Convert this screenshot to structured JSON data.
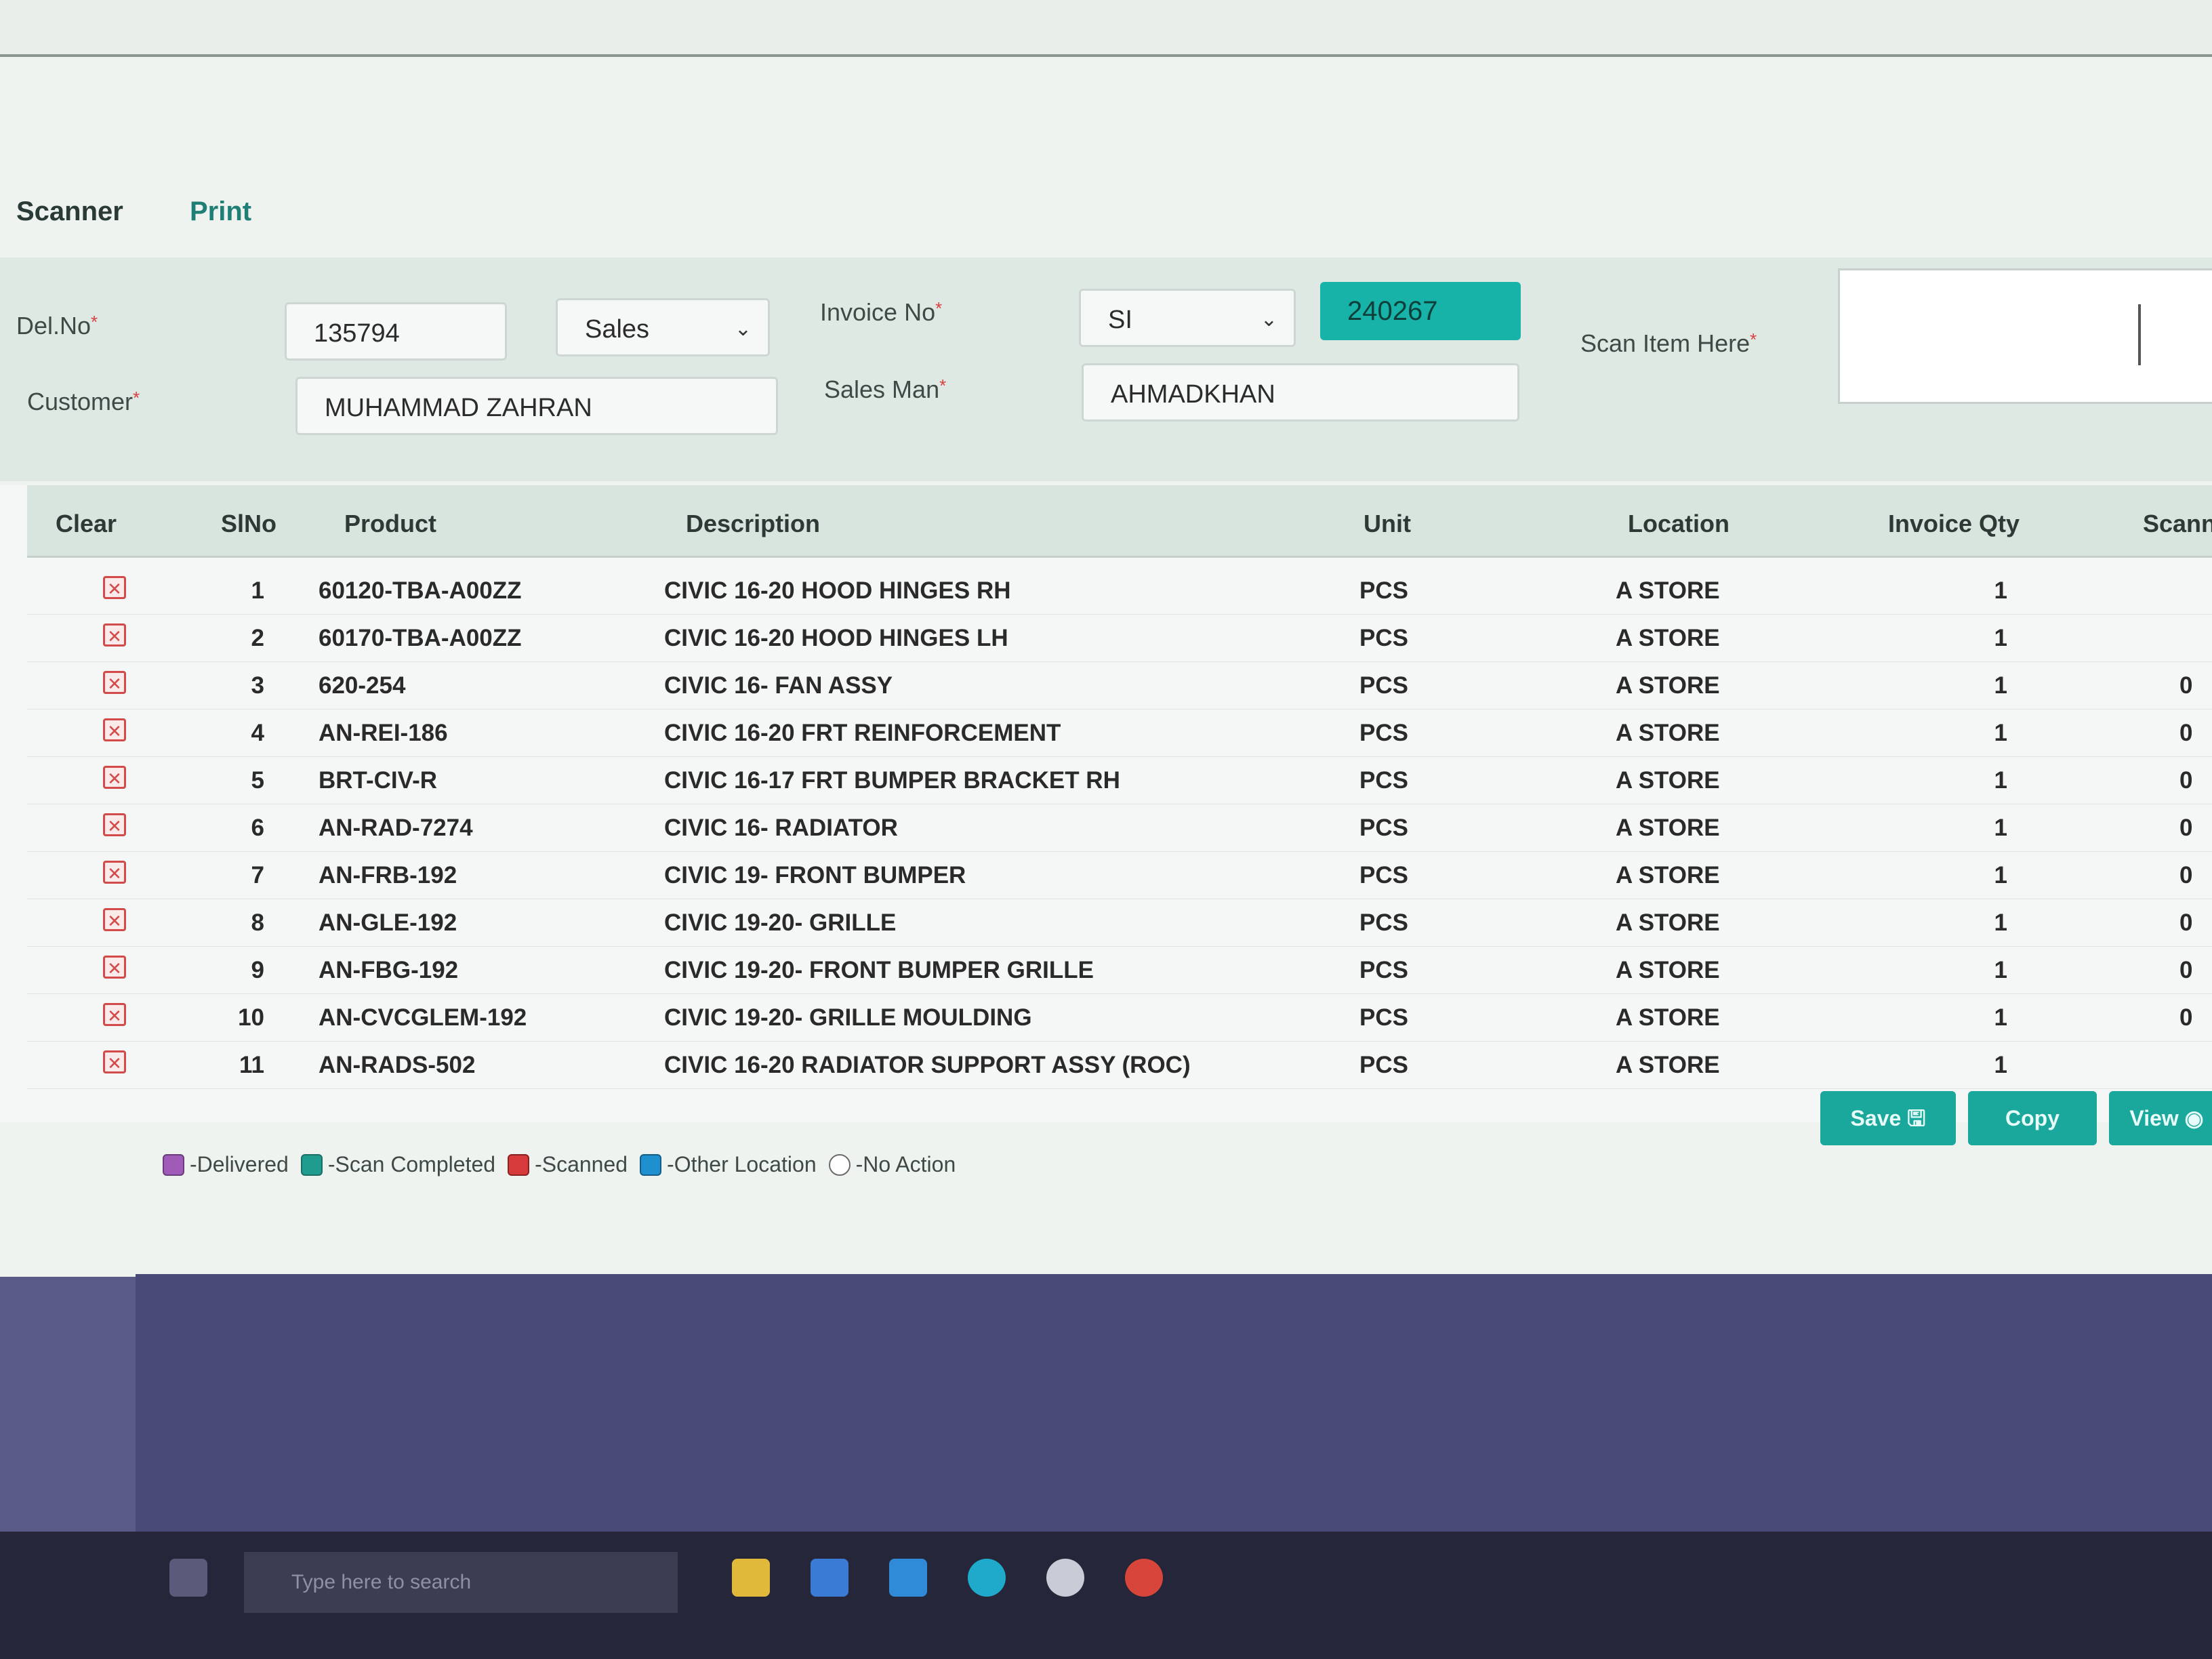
{
  "tabs": [
    {
      "label": "Scanner"
    },
    {
      "label": "Print"
    }
  ],
  "form": {
    "del_no_label": "Del.No",
    "del_no_value": "135794",
    "del_type_value": "Sales",
    "invoice_no_label": "Invoice No",
    "invoice_type_value": "SI",
    "invoice_number_value": "240267",
    "customer_label": "Customer",
    "customer_value": "MUHAMMAD ZAHRAN",
    "sales_man_label": "Sales Man",
    "sales_man_value": "AHMADKHAN",
    "scan_label": "Scan Item Here"
  },
  "table": {
    "headers": {
      "clear": "Clear",
      "slno": "SlNo",
      "product": "Product",
      "description": "Description",
      "unit": "Unit",
      "location": "Location",
      "invoice_qty": "Invoice Qty",
      "scanned": "Scann"
    },
    "rows": [
      {
        "slno": "1",
        "product": "60120-TBA-A00ZZ",
        "description": "CIVIC 16-20 HOOD HINGES RH",
        "unit": "PCS",
        "location": "A STORE",
        "qty": "1",
        "scanned": ""
      },
      {
        "slno": "2",
        "product": "60170-TBA-A00ZZ",
        "description": "CIVIC 16-20 HOOD HINGES LH",
        "unit": "PCS",
        "location": "A STORE",
        "qty": "1",
        "scanned": ""
      },
      {
        "slno": "3",
        "product": "620-254",
        "description": "CIVIC 16- FAN ASSY",
        "unit": "PCS",
        "location": "A STORE",
        "qty": "1",
        "scanned": "0"
      },
      {
        "slno": "4",
        "product": "AN-REI-186",
        "description": "CIVIC 16-20 FRT REINFORCEMENT",
        "unit": "PCS",
        "location": "A STORE",
        "qty": "1",
        "scanned": "0"
      },
      {
        "slno": "5",
        "product": "BRT-CIV-R",
        "description": "CIVIC 16-17 FRT BUMPER BRACKET RH",
        "unit": "PCS",
        "location": "A STORE",
        "qty": "1",
        "scanned": "0"
      },
      {
        "slno": "6",
        "product": "AN-RAD-7274",
        "description": "CIVIC 16- RADIATOR",
        "unit": "PCS",
        "location": "A STORE",
        "qty": "1",
        "scanned": "0"
      },
      {
        "slno": "7",
        "product": "AN-FRB-192",
        "description": "CIVIC 19- FRONT BUMPER",
        "unit": "PCS",
        "location": "A STORE",
        "qty": "1",
        "scanned": "0"
      },
      {
        "slno": "8",
        "product": "AN-GLE-192",
        "description": "CIVIC 19-20- GRILLE",
        "unit": "PCS",
        "location": "A STORE",
        "qty": "1",
        "scanned": "0"
      },
      {
        "slno": "9",
        "product": "AN-FBG-192",
        "description": "CIVIC 19-20- FRONT BUMPER GRILLE",
        "unit": "PCS",
        "location": "A STORE",
        "qty": "1",
        "scanned": "0"
      },
      {
        "slno": "10",
        "product": "AN-CVCGLEM-192",
        "description": "CIVIC 19-20- GRILLE MOULDING",
        "unit": "PCS",
        "location": "A STORE",
        "qty": "1",
        "scanned": "0"
      },
      {
        "slno": "11",
        "product": "AN-RADS-502",
        "description": "CIVIC 16-20 RADIATOR SUPPORT ASSY (ROC)",
        "unit": "PCS",
        "location": "A STORE",
        "qty": "1",
        "scanned": ""
      }
    ]
  },
  "legend": [
    {
      "label": "-Delivered",
      "color": "#a05ab8"
    },
    {
      "label": "-Scan Completed",
      "color": "#1f9c8d"
    },
    {
      "label": "-Scanned",
      "color": "#d63a3a"
    },
    {
      "label": "-Other Location",
      "color": "#1f8fcf"
    },
    {
      "label": "-No Action",
      "color": "#ffffff"
    }
  ],
  "buttons": {
    "save": "Save",
    "copy": "Copy",
    "view": "View"
  },
  "taskbar": {
    "search_placeholder": "Type here to search"
  }
}
